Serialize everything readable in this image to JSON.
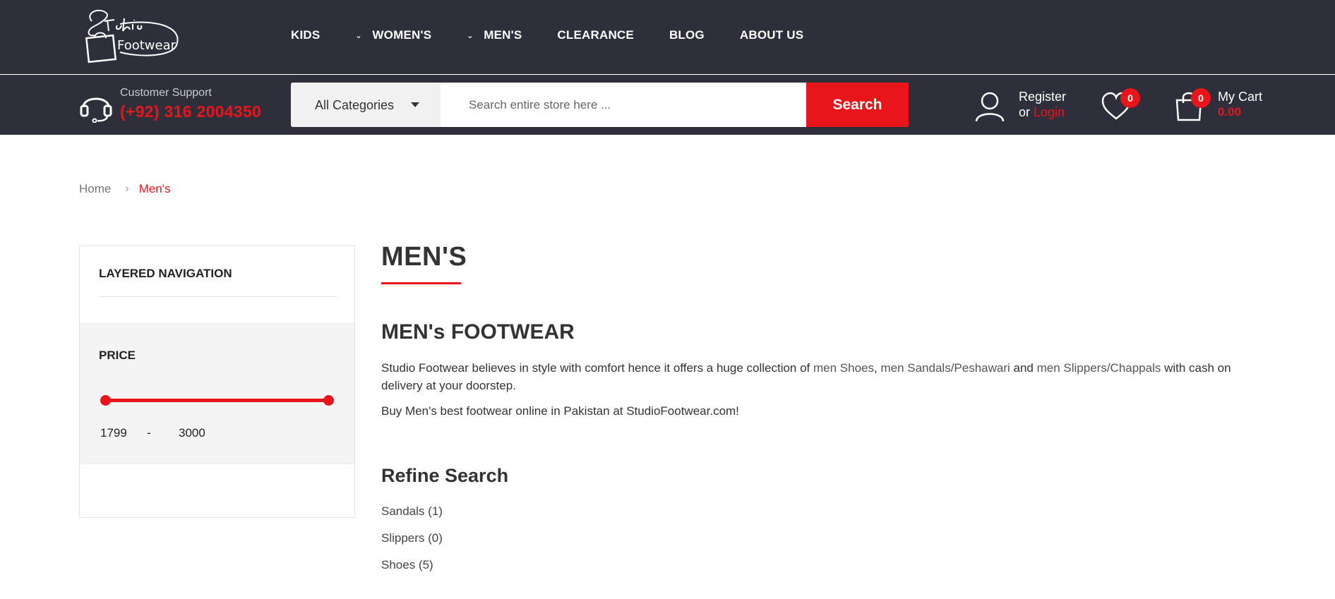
{
  "brand": {
    "script_text": "Studio",
    "word": "Footwear"
  },
  "nav": {
    "items": [
      {
        "label": "KIDS",
        "has_dropdown": false
      },
      {
        "label": "WOMEN'S",
        "has_dropdown": true
      },
      {
        "label": "MEN'S",
        "has_dropdown": true
      },
      {
        "label": "CLEARANCE",
        "has_dropdown": false
      },
      {
        "label": "BLOG",
        "has_dropdown": false
      },
      {
        "label": "ABOUT US",
        "has_dropdown": false
      }
    ]
  },
  "support": {
    "label": "Customer Support",
    "phone": "(+92) 316 2004350",
    "icon": "headset-icon"
  },
  "search": {
    "category": "All Categories",
    "placeholder": "Search entire store here ...",
    "button_label": "Search"
  },
  "account": {
    "register": "Register",
    "or": "or",
    "login": "Login",
    "icon": "user-icon"
  },
  "wishlist": {
    "count": "0",
    "icon": "heart-icon"
  },
  "cart": {
    "label": "My Cart",
    "amount": "0.00",
    "count": "0",
    "icon": "shopping-bag-icon"
  },
  "breadcrumb": {
    "home": "Home",
    "separator": "›",
    "current": "Men's"
  },
  "sidebar": {
    "title": "LAYERED NAVIGATION",
    "price": {
      "title": "PRICE",
      "min": "1799",
      "dash": "-",
      "max": "3000"
    }
  },
  "content": {
    "title": "MEN'S",
    "section_title": "MEN's FOOTWEAR",
    "description": {
      "part1": "Studio Footwear believes in style with comfort hence it offers a huge collection of ",
      "link1": "men Shoes",
      "comma": ", ",
      "link2": "men Sandals/Peshawari",
      "and": " and ",
      "link3": "men Slippers/Chappals",
      "part2": " with cash on delivery at your doorstep."
    },
    "description2": "Buy Men's best footwear online in Pakistan at StudioFootwear.com!",
    "refine_title": "Refine Search",
    "refine_items": [
      "Sandals (1)",
      "Slippers (0)",
      "Shoes (5)"
    ]
  },
  "colors": {
    "header_bg": "#2e2f3a",
    "accent": "#e8161b",
    "panel_bg": "#f4f4f4"
  }
}
